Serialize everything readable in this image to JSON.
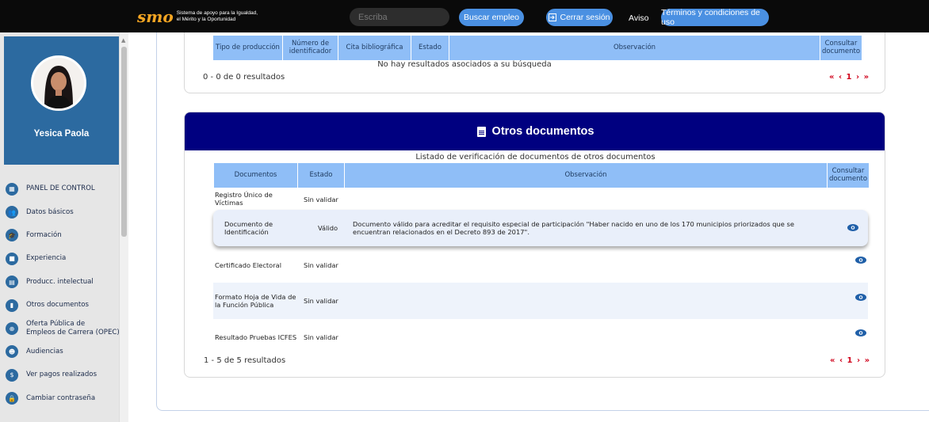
{
  "topbar": {
    "logo_mark": "smo",
    "logo_line1": "Sistema de apoyo para la Igualdad,",
    "logo_line2": "el Mérito y la Oportunidad",
    "search_placeholder": "Escriba",
    "buscar_label": "Buscar empleo",
    "cerrar_label": "Cerrar sesión",
    "aviso_label": "Aviso",
    "terminos_label": "Términos y condiciones de uso"
  },
  "profile": {
    "name": "Yesica Paola"
  },
  "sidebar": {
    "items": [
      {
        "label": "PANEL DE CONTROL",
        "icon": "dashboard-icon"
      },
      {
        "label": "Datos básicos",
        "icon": "users-icon"
      },
      {
        "label": "Formación",
        "icon": "graduation-icon"
      },
      {
        "label": "Experiencia",
        "icon": "briefcase-icon"
      },
      {
        "label": "Producc. intelectual",
        "icon": "book-icon"
      },
      {
        "label": "Otros documentos",
        "icon": "document-icon"
      },
      {
        "label": "Oferta Pública de",
        "label2": "Empleos de Carrera (OPEC)",
        "icon": "globe-icon"
      },
      {
        "label": "Audiencias",
        "icon": "audience-icon"
      },
      {
        "label": "Ver pagos realizados",
        "icon": "dollar-icon"
      },
      {
        "label": "Cambiar contraseña",
        "icon": "lock-icon"
      }
    ]
  },
  "produccion": {
    "headers": [
      "Tipo de producción",
      "Número de identificador",
      "Cita bibliográfica",
      "Estado",
      "Observación",
      "Consultar documento"
    ],
    "no_results": "No hay resultados asociados a su búsqueda",
    "count_text": "0 - 0 de 0 resultados",
    "pager": "« ‹ 1 › »"
  },
  "otros": {
    "title": "Otros documentos",
    "list_title": "Listado de verificación de documentos de otros documentos",
    "headers": [
      "Documentos",
      "Estado",
      "Observación",
      "Consultar documento"
    ],
    "rows": [
      {
        "doc": "Registro Único de Víctimas",
        "estado": "Sin validar",
        "obs": "",
        "has_eye": false
      },
      {
        "doc": "Documento de Identificación",
        "estado": "Válido",
        "obs": "Documento válido para acreditar el requisito especial de participación \"Haber nacido en uno de los 170 municipios priorizados que se encuentran relacionados en el Decreto 893 de 2017\".",
        "has_eye": true
      },
      {
        "doc": "Certificado Electoral",
        "estado": "Sin validar",
        "obs": "",
        "has_eye": true
      },
      {
        "doc": "Formato Hoja de Vida de la Función Pública",
        "estado": "Sin validar",
        "obs": "",
        "has_eye": true
      },
      {
        "doc": "Resultado Pruebas ICFES",
        "estado": "Sin validar",
        "obs": "",
        "has_eye": true
      }
    ],
    "count_text": "1 - 5 de 5 resultados",
    "pager": "« ‹ 1 › »"
  },
  "colors": {
    "accent_blue": "#4a90e2",
    "header_navy": "#000080",
    "table_header": "#8fbef7",
    "pager_red": "#d0021b",
    "profile_blue": "#2c6aa0"
  }
}
